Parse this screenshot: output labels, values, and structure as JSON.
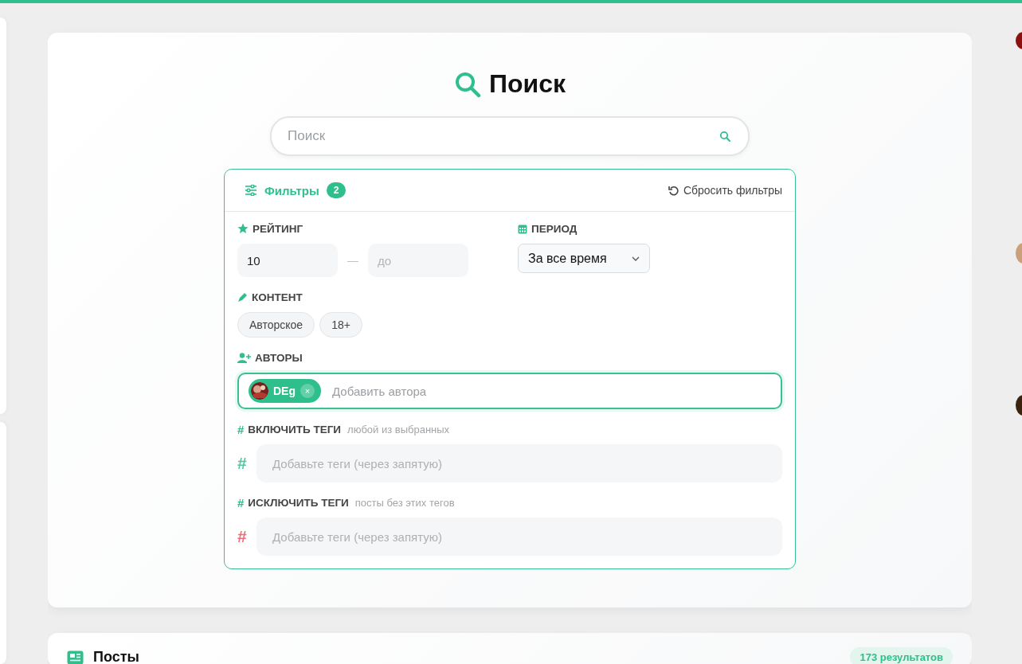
{
  "page_title": "Поиск",
  "search": {
    "placeholder": "Поиск"
  },
  "filters": {
    "title": "Фильтры",
    "count": "2",
    "reset": "Сбросить фильтры",
    "rating": {
      "label": "РЕЙТИНГ",
      "from_value": "10",
      "separator": "—",
      "to_placeholder": "до"
    },
    "period": {
      "label": "ПЕРИОД",
      "value": "За все время"
    },
    "content": {
      "label": "КОНТЕНТ",
      "chips": [
        {
          "label": "Авторское",
          "selected": false
        },
        {
          "label": "18+",
          "selected": false
        }
      ]
    },
    "authors": {
      "label": "АВТОРЫ",
      "focused": true,
      "chips": [
        {
          "name": "DEg",
          "remove": "×"
        }
      ],
      "placeholder": "Добавить автора"
    },
    "tag_fields": [
      {
        "kind": "include",
        "label": "ВКЛЮЧИТЬ ТЕГИ",
        "hint": "любой из выбранных",
        "mark": "#",
        "placeholder": "Добавьте теги (через запятую)"
      },
      {
        "kind": "exclude",
        "label": "ИСКЛЮЧИТЬ ТЕГИ",
        "hint": "посты без этих тегов",
        "mark": "#",
        "placeholder": "Добавьте теги (через запятую)"
      }
    ]
  },
  "posts": {
    "title": "Посты",
    "count": "173 результатов"
  }
}
